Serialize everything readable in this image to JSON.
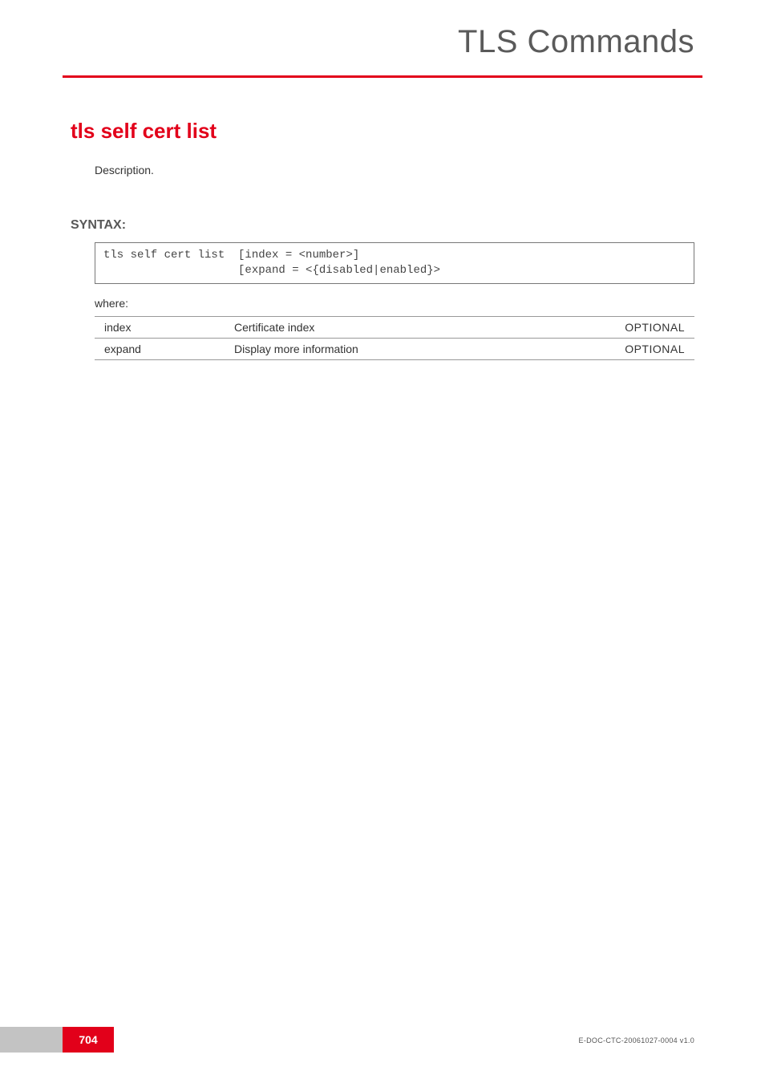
{
  "header": {
    "title": "TLS Commands"
  },
  "section": {
    "title": "tls self cert list",
    "description": "Description."
  },
  "syntax": {
    "label": "SYNTAX:",
    "code": "tls self cert list  [index = <number>]\n                    [expand = <{disabled|enabled}>"
  },
  "where_label": "where:",
  "params": [
    {
      "name": "index",
      "desc": "Certificate index",
      "flag": "OPTIONAL"
    },
    {
      "name": "expand",
      "desc": "Display more information",
      "flag": "OPTIONAL"
    }
  ],
  "footer": {
    "page_number": "704",
    "doc_id": "E-DOC-CTC-20061027-0004 v1.0"
  }
}
